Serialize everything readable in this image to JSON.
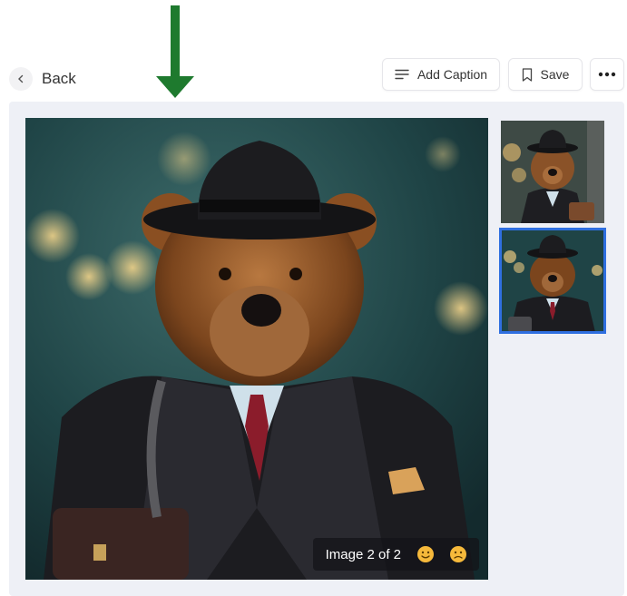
{
  "header": {
    "back_label": "Back",
    "add_caption_label": "Add Caption",
    "save_label": "Save"
  },
  "viewer": {
    "counter_text": "Image 2 of 2",
    "selected_index": 2,
    "total_images": 2
  },
  "icons": {
    "back": "chevron-left-icon",
    "add_caption": "text-lines-icon",
    "save": "bookmark-icon",
    "more": "more-horizontal-icon",
    "like": "smile-face-icon",
    "dislike": "frown-face-icon"
  },
  "colors": {
    "arrow": "#1e7a2e",
    "panel_bg": "#eef0f6",
    "selected_outline": "#2f6fe0",
    "emoji": "#f6b93b"
  }
}
